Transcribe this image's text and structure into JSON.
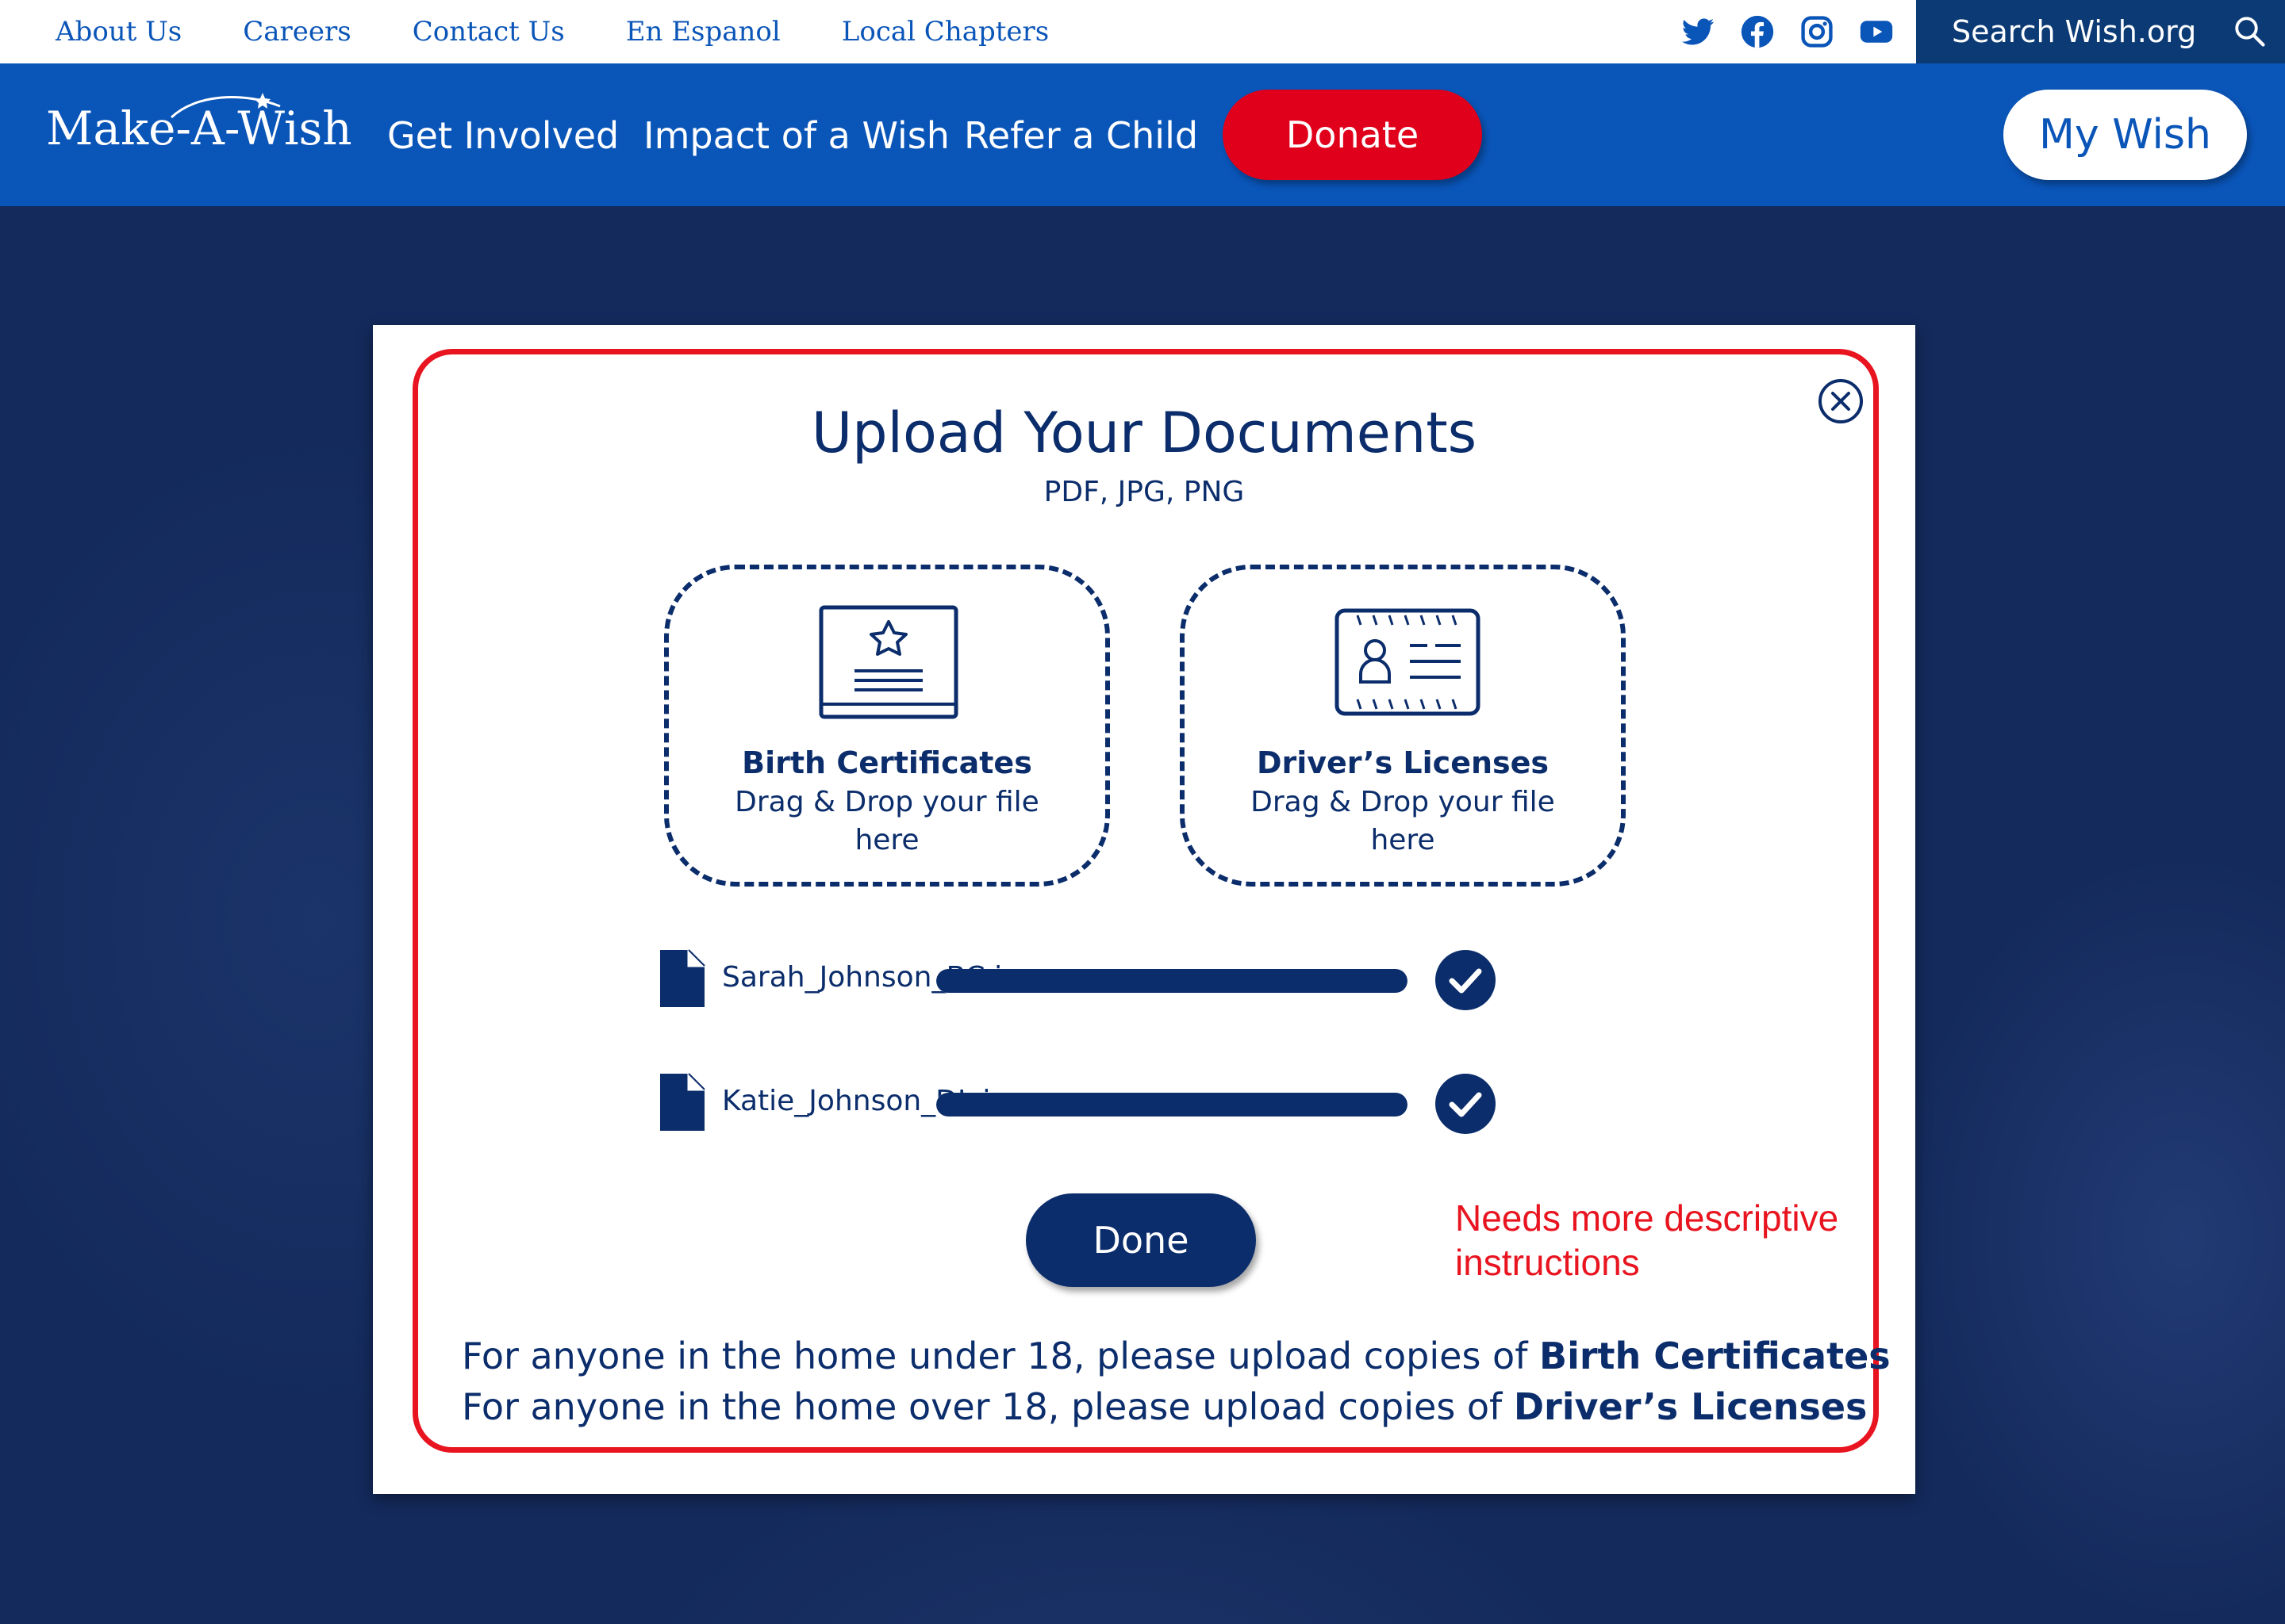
{
  "utility_bar": {
    "links": [
      "About Us",
      "Careers",
      "Contact Us",
      "En Espanol",
      "Local Chapters"
    ],
    "social_icons": [
      "twitter-icon",
      "facebook-icon",
      "instagram-icon",
      "youtube-icon"
    ],
    "search_label": "Search Wish.org"
  },
  "nav": {
    "logo_text": "Make-A-Wish",
    "links": [
      "Get Involved",
      "Impact of a Wish",
      "Refer a Child"
    ],
    "donate_label": "Donate",
    "my_wish_label": "My Wish",
    "colors": {
      "nav_blue": "#0a55b8",
      "donate_red": "#e0001b"
    }
  },
  "modal": {
    "title": "Upload Your Documents",
    "subtitle": "PDF, JPG, PNG",
    "dropzones": [
      {
        "title": "Birth Certificates",
        "text": "Drag & Drop your file here",
        "icon": "certificate-icon"
      },
      {
        "title": "Driver’s Licenses",
        "text": "Drag & Drop your file here",
        "icon": "id-card-icon"
      }
    ],
    "files": [
      {
        "name": "Sarah_Johnson_BC.jpg",
        "progress_percent": 100,
        "status_icon": "check-circle-icon"
      },
      {
        "name": "Katie_Johnson_DL.jpg",
        "progress_percent": 100,
        "status_icon": "check-circle-icon"
      }
    ],
    "done_label": "Done",
    "annotation_note": "Needs more descriptive instructions",
    "instructions": [
      {
        "prefix": "For anyone in the home under 18, please upload copies of ",
        "emphasis": "Birth Certificates"
      },
      {
        "prefix": "For anyone in the home over 18, please upload copies of ",
        "emphasis": "Driver’s Licenses"
      }
    ],
    "colors": {
      "navy": "#0b2d6b",
      "annotation_red": "#e8141f"
    }
  }
}
